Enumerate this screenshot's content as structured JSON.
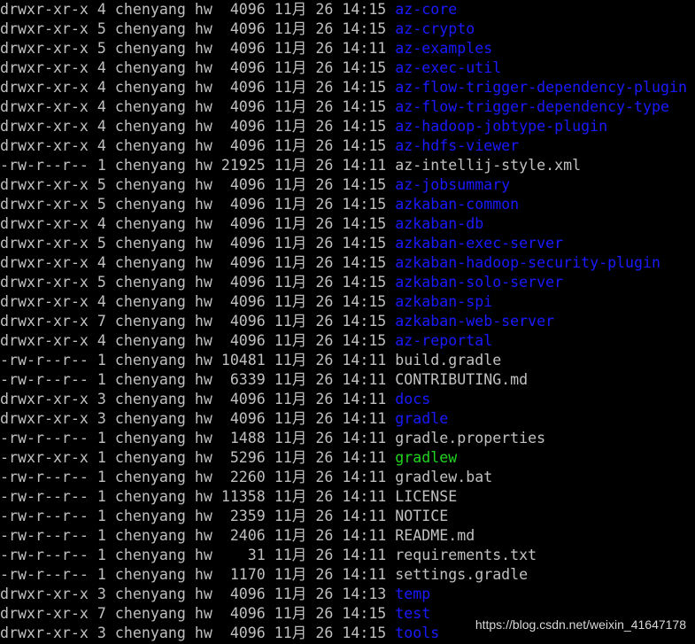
{
  "colors": {
    "background": "#000000",
    "text": "#c0c0c0",
    "directory": "#1a1aff",
    "executable": "#1fd41f"
  },
  "listing": [
    {
      "perms": "drwxr-xr-x",
      "links": "4",
      "owner": "chenyang",
      "group": "hw",
      "size": " 4096",
      "month": "11月",
      "day": "26",
      "time": "14:15",
      "name": "az-core",
      "kind": "dir"
    },
    {
      "perms": "drwxr-xr-x",
      "links": "5",
      "owner": "chenyang",
      "group": "hw",
      "size": " 4096",
      "month": "11月",
      "day": "26",
      "time": "14:15",
      "name": "az-crypto",
      "kind": "dir"
    },
    {
      "perms": "drwxr-xr-x",
      "links": "5",
      "owner": "chenyang",
      "group": "hw",
      "size": " 4096",
      "month": "11月",
      "day": "26",
      "time": "14:11",
      "name": "az-examples",
      "kind": "dir"
    },
    {
      "perms": "drwxr-xr-x",
      "links": "4",
      "owner": "chenyang",
      "group": "hw",
      "size": " 4096",
      "month": "11月",
      "day": "26",
      "time": "14:15",
      "name": "az-exec-util",
      "kind": "dir"
    },
    {
      "perms": "drwxr-xr-x",
      "links": "4",
      "owner": "chenyang",
      "group": "hw",
      "size": " 4096",
      "month": "11月",
      "day": "26",
      "time": "14:15",
      "name": "az-flow-trigger-dependency-plugin",
      "kind": "dir"
    },
    {
      "perms": "drwxr-xr-x",
      "links": "4",
      "owner": "chenyang",
      "group": "hw",
      "size": " 4096",
      "month": "11月",
      "day": "26",
      "time": "14:15",
      "name": "az-flow-trigger-dependency-type",
      "kind": "dir"
    },
    {
      "perms": "drwxr-xr-x",
      "links": "4",
      "owner": "chenyang",
      "group": "hw",
      "size": " 4096",
      "month": "11月",
      "day": "26",
      "time": "14:15",
      "name": "az-hadoop-jobtype-plugin",
      "kind": "dir"
    },
    {
      "perms": "drwxr-xr-x",
      "links": "4",
      "owner": "chenyang",
      "group": "hw",
      "size": " 4096",
      "month": "11月",
      "day": "26",
      "time": "14:15",
      "name": "az-hdfs-viewer",
      "kind": "dir"
    },
    {
      "perms": "-rw-r--r--",
      "links": "1",
      "owner": "chenyang",
      "group": "hw",
      "size": "21925",
      "month": "11月",
      "day": "26",
      "time": "14:11",
      "name": "az-intellij-style.xml",
      "kind": "file"
    },
    {
      "perms": "drwxr-xr-x",
      "links": "5",
      "owner": "chenyang",
      "group": "hw",
      "size": " 4096",
      "month": "11月",
      "day": "26",
      "time": "14:15",
      "name": "az-jobsummary",
      "kind": "dir"
    },
    {
      "perms": "drwxr-xr-x",
      "links": "5",
      "owner": "chenyang",
      "group": "hw",
      "size": " 4096",
      "month": "11月",
      "day": "26",
      "time": "14:15",
      "name": "azkaban-common",
      "kind": "dir"
    },
    {
      "perms": "drwxr-xr-x",
      "links": "4",
      "owner": "chenyang",
      "group": "hw",
      "size": " 4096",
      "month": "11月",
      "day": "26",
      "time": "14:15",
      "name": "azkaban-db",
      "kind": "dir"
    },
    {
      "perms": "drwxr-xr-x",
      "links": "5",
      "owner": "chenyang",
      "group": "hw",
      "size": " 4096",
      "month": "11月",
      "day": "26",
      "time": "14:15",
      "name": "azkaban-exec-server",
      "kind": "dir"
    },
    {
      "perms": "drwxr-xr-x",
      "links": "4",
      "owner": "chenyang",
      "group": "hw",
      "size": " 4096",
      "month": "11月",
      "day": "26",
      "time": "14:15",
      "name": "azkaban-hadoop-security-plugin",
      "kind": "dir"
    },
    {
      "perms": "drwxr-xr-x",
      "links": "5",
      "owner": "chenyang",
      "group": "hw",
      "size": " 4096",
      "month": "11月",
      "day": "26",
      "time": "14:15",
      "name": "azkaban-solo-server",
      "kind": "dir"
    },
    {
      "perms": "drwxr-xr-x",
      "links": "4",
      "owner": "chenyang",
      "group": "hw",
      "size": " 4096",
      "month": "11月",
      "day": "26",
      "time": "14:15",
      "name": "azkaban-spi",
      "kind": "dir"
    },
    {
      "perms": "drwxr-xr-x",
      "links": "7",
      "owner": "chenyang",
      "group": "hw",
      "size": " 4096",
      "month": "11月",
      "day": "26",
      "time": "14:15",
      "name": "azkaban-web-server",
      "kind": "dir"
    },
    {
      "perms": "drwxr-xr-x",
      "links": "4",
      "owner": "chenyang",
      "group": "hw",
      "size": " 4096",
      "month": "11月",
      "day": "26",
      "time": "14:15",
      "name": "az-reportal",
      "kind": "dir"
    },
    {
      "perms": "-rw-r--r--",
      "links": "1",
      "owner": "chenyang",
      "group": "hw",
      "size": "10481",
      "month": "11月",
      "day": "26",
      "time": "14:11",
      "name": "build.gradle",
      "kind": "file"
    },
    {
      "perms": "-rw-r--r--",
      "links": "1",
      "owner": "chenyang",
      "group": "hw",
      "size": " 6339",
      "month": "11月",
      "day": "26",
      "time": "14:11",
      "name": "CONTRIBUTING.md",
      "kind": "file"
    },
    {
      "perms": "drwxr-xr-x",
      "links": "3",
      "owner": "chenyang",
      "group": "hw",
      "size": " 4096",
      "month": "11月",
      "day": "26",
      "time": "14:11",
      "name": "docs",
      "kind": "dir"
    },
    {
      "perms": "drwxr-xr-x",
      "links": "3",
      "owner": "chenyang",
      "group": "hw",
      "size": " 4096",
      "month": "11月",
      "day": "26",
      "time": "14:11",
      "name": "gradle",
      "kind": "dir"
    },
    {
      "perms": "-rw-r--r--",
      "links": "1",
      "owner": "chenyang",
      "group": "hw",
      "size": " 1488",
      "month": "11月",
      "day": "26",
      "time": "14:11",
      "name": "gradle.properties",
      "kind": "file"
    },
    {
      "perms": "-rwxr-xr-x",
      "links": "1",
      "owner": "chenyang",
      "group": "hw",
      "size": " 5296",
      "month": "11月",
      "day": "26",
      "time": "14:11",
      "name": "gradlew",
      "kind": "exec"
    },
    {
      "perms": "-rw-r--r--",
      "links": "1",
      "owner": "chenyang",
      "group": "hw",
      "size": " 2260",
      "month": "11月",
      "day": "26",
      "time": "14:11",
      "name": "gradlew.bat",
      "kind": "file"
    },
    {
      "perms": "-rw-r--r--",
      "links": "1",
      "owner": "chenyang",
      "group": "hw",
      "size": "11358",
      "month": "11月",
      "day": "26",
      "time": "14:11",
      "name": "LICENSE",
      "kind": "file"
    },
    {
      "perms": "-rw-r--r--",
      "links": "1",
      "owner": "chenyang",
      "group": "hw",
      "size": " 2359",
      "month": "11月",
      "day": "26",
      "time": "14:11",
      "name": "NOTICE",
      "kind": "file"
    },
    {
      "perms": "-rw-r--r--",
      "links": "1",
      "owner": "chenyang",
      "group": "hw",
      "size": " 2406",
      "month": "11月",
      "day": "26",
      "time": "14:11",
      "name": "README.md",
      "kind": "file"
    },
    {
      "perms": "-rw-r--r--",
      "links": "1",
      "owner": "chenyang",
      "group": "hw",
      "size": "   31",
      "month": "11月",
      "day": "26",
      "time": "14:11",
      "name": "requirements.txt",
      "kind": "file"
    },
    {
      "perms": "-rw-r--r--",
      "links": "1",
      "owner": "chenyang",
      "group": "hw",
      "size": " 1170",
      "month": "11月",
      "day": "26",
      "time": "14:11",
      "name": "settings.gradle",
      "kind": "file"
    },
    {
      "perms": "drwxr-xr-x",
      "links": "3",
      "owner": "chenyang",
      "group": "hw",
      "size": " 4096",
      "month": "11月",
      "day": "26",
      "time": "14:13",
      "name": "temp",
      "kind": "dir"
    },
    {
      "perms": "drwxr-xr-x",
      "links": "7",
      "owner": "chenyang",
      "group": "hw",
      "size": " 4096",
      "month": "11月",
      "day": "26",
      "time": "14:15",
      "name": "test",
      "kind": "dir"
    },
    {
      "perms": "drwxr-xr-x",
      "links": "3",
      "owner": "chenyang",
      "group": "hw",
      "size": " 4096",
      "month": "11月",
      "day": "26",
      "time": "14:15",
      "name": "tools",
      "kind": "dir"
    }
  ],
  "watermark": "https://blog.csdn.net/weixin_41647178"
}
